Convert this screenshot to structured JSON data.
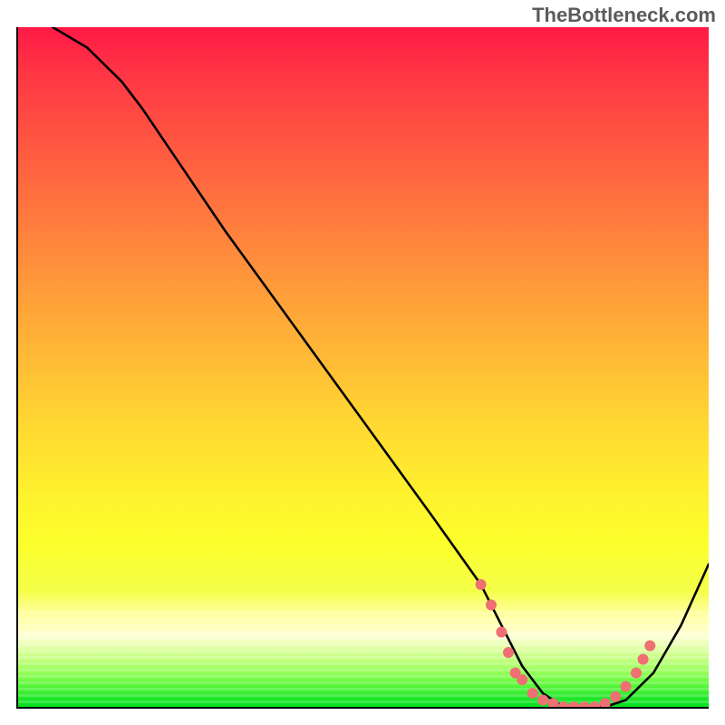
{
  "watermark": "TheBottleneck.com",
  "chart_data": {
    "type": "line",
    "title": "",
    "xlabel": "",
    "ylabel": "",
    "xlim": [
      0,
      100
    ],
    "ylim": [
      0,
      100
    ],
    "background": {
      "kind": "vertical-gradient",
      "stops": [
        {
          "pos": 0,
          "color": "#ff1a46"
        },
        {
          "pos": 38,
          "color": "#ff9a3a"
        },
        {
          "pos": 68,
          "color": "#fff02e"
        },
        {
          "pos": 88,
          "color": "#ffffc0"
        },
        {
          "pos": 100,
          "color": "#00dd22"
        }
      ]
    },
    "series": [
      {
        "name": "bottleneck-curve",
        "color": "#000000",
        "x": [
          5,
          10,
          15,
          18,
          22,
          30,
          40,
          50,
          60,
          67,
          70,
          73,
          76,
          79,
          82,
          85,
          88,
          92,
          96,
          100
        ],
        "y": [
          100,
          97,
          92,
          88,
          82,
          70,
          56,
          42,
          28,
          18,
          12,
          6,
          2,
          0,
          0,
          0,
          1,
          5,
          12,
          21
        ]
      }
    ],
    "markers": {
      "name": "highlighted-points",
      "color": "#ef6f72",
      "radius": 6,
      "points": [
        {
          "x": 67,
          "y": 18
        },
        {
          "x": 68.5,
          "y": 15
        },
        {
          "x": 70,
          "y": 11
        },
        {
          "x": 71,
          "y": 8
        },
        {
          "x": 72,
          "y": 5
        },
        {
          "x": 73,
          "y": 4
        },
        {
          "x": 74.5,
          "y": 2
        },
        {
          "x": 76,
          "y": 1
        },
        {
          "x": 77.5,
          "y": 0.5
        },
        {
          "x": 79,
          "y": 0
        },
        {
          "x": 80.5,
          "y": 0
        },
        {
          "x": 82,
          "y": 0
        },
        {
          "x": 83.5,
          "y": 0
        },
        {
          "x": 85,
          "y": 0.5
        },
        {
          "x": 86.5,
          "y": 1.5
        },
        {
          "x": 88,
          "y": 3
        },
        {
          "x": 89.5,
          "y": 5
        },
        {
          "x": 90.5,
          "y": 7
        },
        {
          "x": 91.5,
          "y": 9
        }
      ]
    }
  }
}
